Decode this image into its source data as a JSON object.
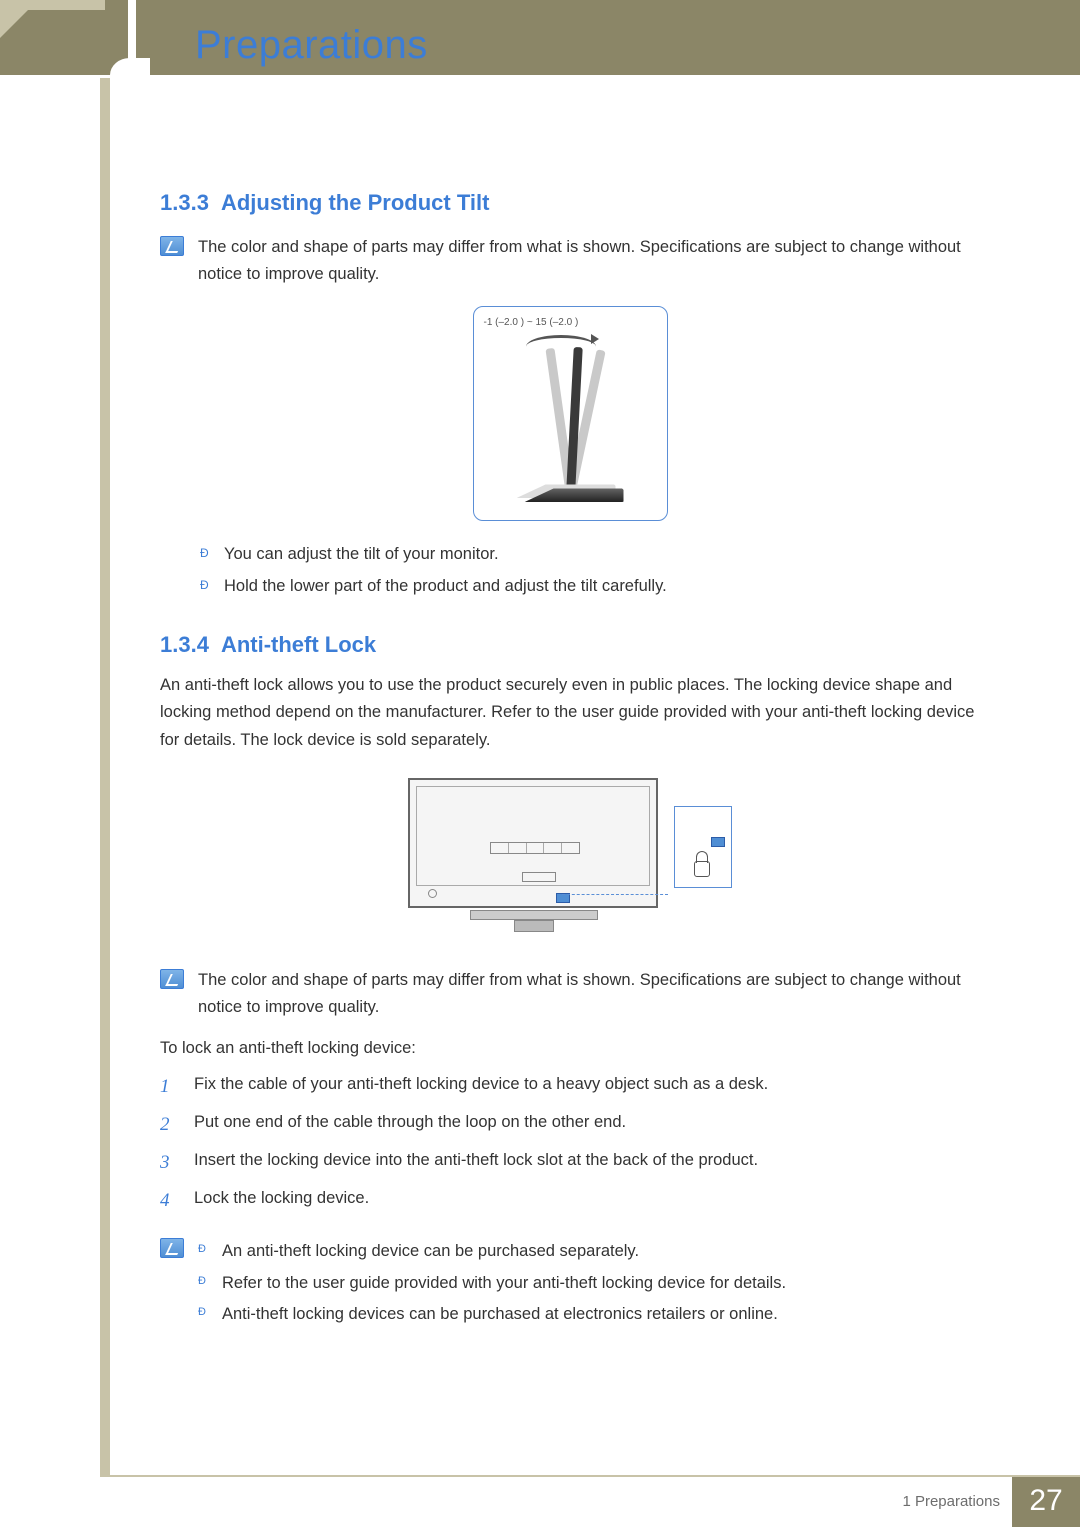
{
  "chapter": {
    "title": "Preparations"
  },
  "section1": {
    "number": "1.3.3",
    "title": "Adjusting the Product Tilt",
    "note": "The color and shape of parts may differ from what is shown. Specifications are subject to change without notice to improve quality.",
    "tilt_range": "-1  (–2.0 ) ~ 15  (–2.0 )",
    "bullets": [
      "You can adjust the tilt of your monitor.",
      "Hold the lower part of the product and adjust the tilt carefully."
    ]
  },
  "section2": {
    "number": "1.3.4",
    "title": "Anti-theft Lock",
    "intro": "An anti-theft lock allows you to use the product securely even in public places. The locking device shape and locking method depend on the manufacturer. Refer to the user guide provided with your anti-theft locking device for details. The lock device is sold separately.",
    "note": "The color and shape of parts may differ from what is shown. Specifications are subject to change without notice to improve quality.",
    "instruction": "To lock an anti-theft locking device:",
    "steps": [
      "Fix the cable of your anti-theft locking device to a heavy object such as a desk.",
      "Put one end of the cable through the loop on the other end.",
      "Insert the locking device into the anti-theft lock slot at the back of the product.",
      "Lock the locking device."
    ],
    "sub_bullets": [
      "An anti-theft locking device can be purchased separately.",
      "Refer to the user guide provided with your anti-theft locking device for details.",
      "Anti-theft locking devices can be purchased at electronics retailers or online."
    ]
  },
  "footer": {
    "section_label": "1 Preparations",
    "page": "27"
  }
}
